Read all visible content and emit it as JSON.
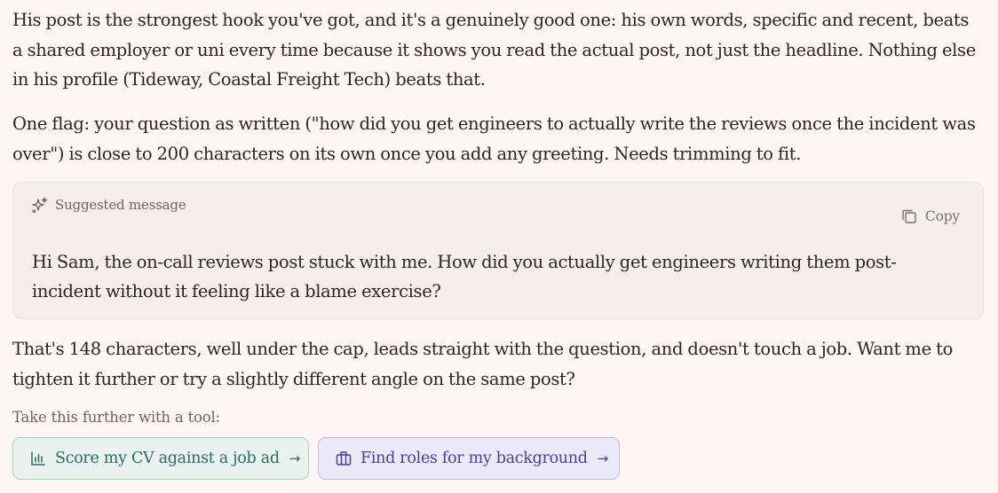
{
  "paragraphs": {
    "p1": [
      "His post is the strongest hook you've got, and it's a genuinely good one: his own words, specific and recent, beats",
      "a shared employer or uni every time because it shows you read the actual post, not just the headline. Nothing else",
      "in his profile (Tideway, Coastal Freight Tech) beats that."
    ],
    "p2": [
      "One flag: your question as written (\"how did you get engineers to actually write the reviews once the incident was",
      "over\") is close to 200 characters on its own once you add any greeting. Needs trimming to fit."
    ],
    "p3": [
      "That's 148 characters, well under the cap, leads straight with the question, and doesn't touch a job. Want me to",
      "tighten it further or try a slightly different angle on the same post?"
    ]
  },
  "suggestion": {
    "header_label": "Suggested message",
    "header_icon": "sparkle-icon",
    "copy_label": "Copy",
    "copy_icon": "copy-icon",
    "message_lines": [
      "Hi Sam, the on-call reviews post stuck with me. How did you actually get engineers writing them post-",
      "incident without it feeling like a blame exercise?"
    ]
  },
  "tools": {
    "label": "Take this further with a tool:",
    "buttons": [
      {
        "label": "Score my CV against a job ad",
        "icon": "bar-chart-icon",
        "arrow": "→",
        "color": "#2d6a60"
      },
      {
        "label": "Find roles for my background",
        "icon": "briefcase-icon",
        "arrow": "→",
        "color": "#4b3f96"
      }
    ]
  }
}
